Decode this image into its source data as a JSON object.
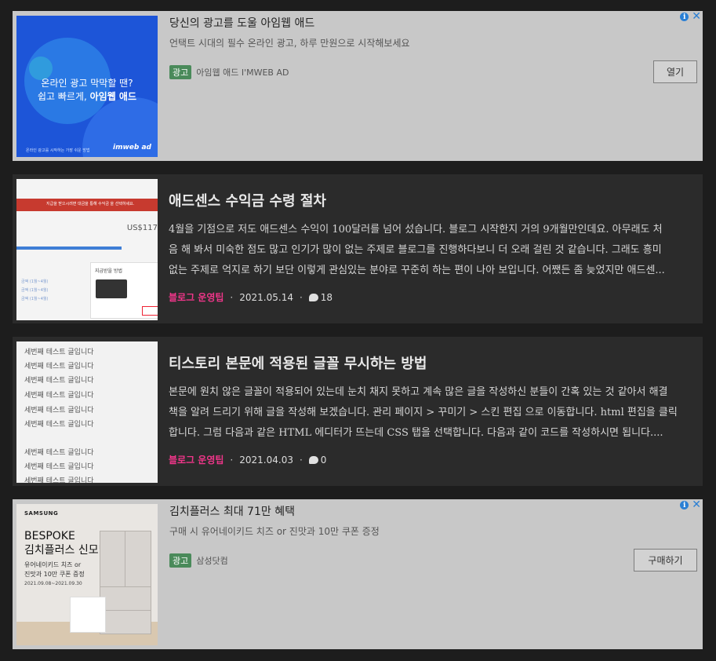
{
  "ad1": {
    "title": "당신의 광고를 도울 아임웹 애드",
    "description": "언택트 시대의 필수 온라인 광고, 하루 만원으로 시작해보세요",
    "badge": "광고",
    "advertiser": "아임웹 애드 I'MWEB AD",
    "button_label": "열기",
    "thumb_line1": "온라인 광고 막막할 땐?",
    "thumb_line2_a": "쉽고 빠르게, ",
    "thumb_line2_b": "아임웹 애드",
    "thumb_footer": "온라인 광고를 시작하는 가장 쉬운 방법",
    "thumb_logo": "imweb ad",
    "icons": [
      "info-icon",
      "close-icon"
    ]
  },
  "posts": [
    {
      "title": "애드센스 수익금 수령 절차",
      "excerpt_lines": [
        "4월을 기점으로 저도 애드센스 수익이 100달러를 넘어 섰습니다. 블로그 시작한지 거의 9개월만인데요. 아무래도 처",
        "음 해 봐서 미숙한 점도 많고 인기가 많이 없는 주제로 블로그를 진행하다보니 더 오래 걸린 것 같습니다. 그래도 흥미",
        "없는 주제로 억지로 하기 보단 이렇게 관심있는 분야로 꾸준히 하는 편이 나아 보입니다. 어쨌든 좀 늦었지만 애드센..."
      ],
      "category": "블로그 운영팁",
      "date": "2021.05.14",
      "comments": "18",
      "thumb": {
        "banner": "지급을 받으시려면 대금을 통해 수익금 을 선택하세요.",
        "amount": "US$117",
        "box_title": "지급받을 방법",
        "rows": [
          "금액 (1월~4월)",
          "금액 (1월~4월)",
          "금액 (1월~4월)"
        ]
      }
    },
    {
      "title": "티스토리 본문에 적용된 글꼴 무시하는 방법",
      "excerpt_lines": [
        "본문에 원치 않은 글꼴이 적용되어 있는데 눈치 채지 못하고 계속 많은 글을 작성하신 분들이 간혹 있는 것 같아서 해결",
        "책을 알려 드리기 위해 글을 작성해 보겠습니다. 관리 페이지 > 꾸미기 > 스킨 편집 으로 이동합니다. html 편집을 클릭",
        "합니다. 그럼 다음과 같은 HTML 에디터가 뜨는데 CSS 탭을 선택합니다. 다음과 같이 코드를 작성하시면 됩니다...."
      ],
      "category": "블로그 운영팁",
      "date": "2021.04.03",
      "comments": "0",
      "thumb_lines": [
        "세번째 테스트 글입니다",
        "세번째 테스트 글입니다",
        "세번째 테스트 글입니다",
        "세번째 테스트 글입니다",
        "세번째 테스트 글입니다",
        "세번째 테스트 글입니다",
        "세번째 테스트 글입니다",
        "세번째 테스트 글입니다",
        "세번째 테스트 글입니다"
      ]
    }
  ],
  "ad2": {
    "title": "김치플러스 최대 71만 혜택",
    "description": "구매 시 유어네이키드 치즈 or 진맛과 10만 쿠폰 증정",
    "badge": "광고",
    "advertiser": "삼성닷컴",
    "button_label": "구매하기",
    "thumb_brand": "SAMSUNG",
    "thumb_heading1": "BESPOKE",
    "thumb_heading2": "김치플러스 신모델",
    "thumb_sub1": "유어네이키드 치즈 or",
    "thumb_sub2": "진맛과 10만 쿠폰 증정",
    "thumb_date": "2021.09.08~2021.09.30",
    "icons": [
      "info-icon",
      "close-icon"
    ]
  },
  "colors": {
    "page_bg": "#1d1d1d",
    "ad_bg": "#c8c8c8",
    "post_bg": "#2b2b2b",
    "category": "#f0368a",
    "ad_badge": "#4a8a5a",
    "info_icon": "#2a7fd4"
  }
}
